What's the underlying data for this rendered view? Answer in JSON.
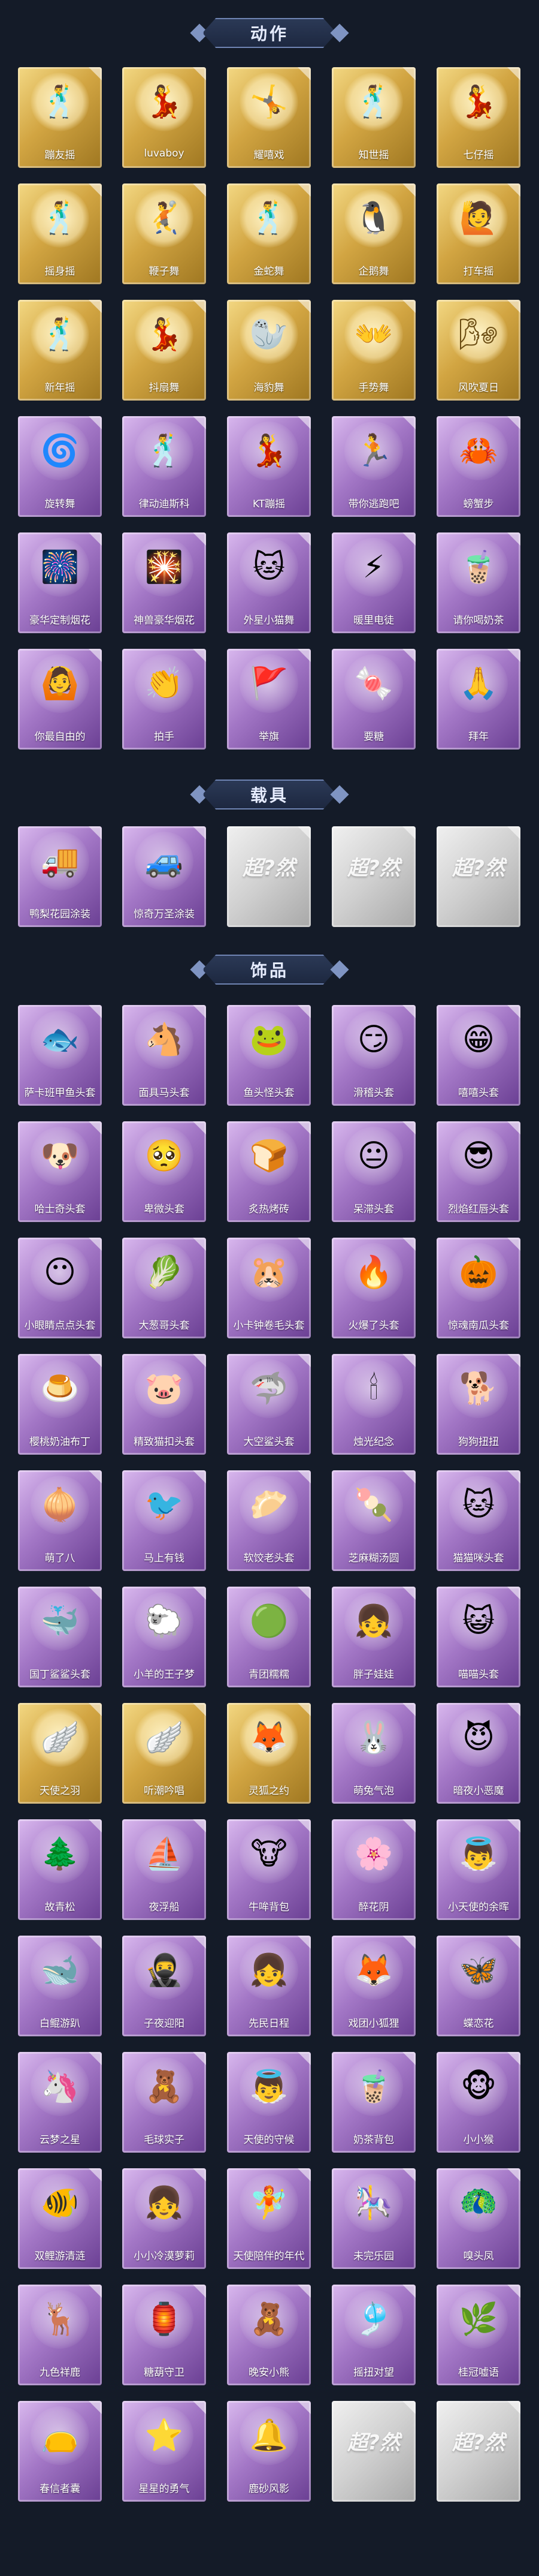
{
  "sections": [
    {
      "title": "动作",
      "items": [
        {
          "label": "蹦友摇",
          "icon": "dance-figure-icon",
          "glyph": "🕺",
          "style": "gold"
        },
        {
          "label": "luvaboy",
          "icon": "dance-figure-icon",
          "glyph": "💃",
          "style": "gold"
        },
        {
          "label": "耀嘻戏",
          "icon": "dance-figure-icon",
          "glyph": "🤸",
          "style": "gold"
        },
        {
          "label": "知世摇",
          "icon": "dance-figure-icon",
          "glyph": "🕺",
          "style": "gold"
        },
        {
          "label": "七仔摇",
          "icon": "dance-figure-icon",
          "glyph": "💃",
          "style": "gold"
        },
        {
          "label": "摇身摇",
          "icon": "dance-figure-icon",
          "glyph": "🕺",
          "style": "gold"
        },
        {
          "label": "鞭子舞",
          "icon": "dance-figure-icon",
          "glyph": "🤾",
          "style": "gold"
        },
        {
          "label": "金蛇舞",
          "icon": "dance-figure-icon",
          "glyph": "🕺",
          "style": "gold"
        },
        {
          "label": "企鹅舞",
          "icon": "dance-figure-icon",
          "glyph": "🐧",
          "style": "gold"
        },
        {
          "label": "打车摇",
          "icon": "dance-figure-icon",
          "glyph": "🙋",
          "style": "gold"
        },
        {
          "label": "新年摇",
          "icon": "dance-figure-icon",
          "glyph": "🕺",
          "style": "gold"
        },
        {
          "label": "抖扇舞",
          "icon": "dance-figure-icon",
          "glyph": "💃",
          "style": "gold"
        },
        {
          "label": "海豹舞",
          "icon": "dance-figure-icon",
          "glyph": "🦭",
          "style": "gold"
        },
        {
          "label": "手势舞",
          "icon": "dance-figure-icon",
          "glyph": "👐",
          "style": "gold"
        },
        {
          "label": "风吹夏日",
          "icon": "dance-figure-icon",
          "glyph": "🌬",
          "style": "gold"
        },
        {
          "label": "旋转舞",
          "icon": "dance-figure-icon",
          "glyph": "🌀",
          "style": "purple"
        },
        {
          "label": "律动迪斯科",
          "icon": "dance-figure-icon",
          "glyph": "🕺",
          "style": "purple"
        },
        {
          "label": "KT蹦摇",
          "icon": "dance-figure-icon",
          "glyph": "💃",
          "style": "purple"
        },
        {
          "label": "带你逃跑吧",
          "icon": "dance-figure-icon",
          "glyph": "🏃",
          "style": "purple"
        },
        {
          "label": "螃蟹步",
          "icon": "dance-figure-icon",
          "glyph": "🦀",
          "style": "purple"
        },
        {
          "label": "豪华定制烟花",
          "icon": "firework-icon",
          "glyph": "🎆",
          "style": "purple"
        },
        {
          "label": "神兽豪华烟花",
          "icon": "firework-icon",
          "glyph": "🎇",
          "style": "purple"
        },
        {
          "label": "外星小猫舞",
          "icon": "dance-figure-icon",
          "glyph": "🐱",
          "style": "purple"
        },
        {
          "label": "暖里电徒",
          "icon": "dance-figure-icon",
          "glyph": "⚡",
          "style": "purple"
        },
        {
          "label": "请你喝奶茶",
          "icon": "dance-figure-icon",
          "glyph": "🧋",
          "style": "purple"
        },
        {
          "label": "你最自由的",
          "icon": "dance-figure-icon",
          "glyph": "🙆",
          "style": "purple"
        },
        {
          "label": "拍手",
          "icon": "dance-figure-icon",
          "glyph": "👏",
          "style": "purple"
        },
        {
          "label": "举旗",
          "icon": "dance-figure-icon",
          "glyph": "🚩",
          "style": "purple"
        },
        {
          "label": "要糖",
          "icon": "dance-figure-icon",
          "glyph": "🍬",
          "style": "purple"
        },
        {
          "label": "拜年",
          "icon": "dance-figure-icon",
          "glyph": "🙏",
          "style": "purple"
        }
      ]
    },
    {
      "title": "载具",
      "items": [
        {
          "label": "鸭梨花园涂装",
          "icon": "vehicle-icon",
          "glyph": "🚚",
          "style": "purple"
        },
        {
          "label": "惊奇万圣涂装",
          "icon": "vehicle-icon",
          "glyph": "🚙",
          "style": "purple"
        },
        {
          "label": "",
          "icon": "placeholder-logo-icon",
          "glyph": "",
          "style": "gray",
          "logo": "超?然"
        },
        {
          "label": "",
          "icon": "placeholder-logo-icon",
          "glyph": "",
          "style": "gray",
          "logo": "超?然"
        },
        {
          "label": "",
          "icon": "placeholder-logo-icon",
          "glyph": "",
          "style": "gray",
          "logo": "超?然"
        }
      ]
    },
    {
      "title": "饰品",
      "items": [
        {
          "label": "萨卡班甲鱼头套",
          "icon": "fish-head-icon",
          "glyph": "🐟",
          "style": "purple"
        },
        {
          "label": "面具马头套",
          "icon": "horse-head-icon",
          "glyph": "🐴",
          "style": "purple"
        },
        {
          "label": "鱼头怪头套",
          "icon": "fish-head-icon",
          "glyph": "🐸",
          "style": "purple"
        },
        {
          "label": "滑稽头套",
          "icon": "smiley-icon",
          "glyph": "😏",
          "style": "purple"
        },
        {
          "label": "嘻嘻头套",
          "icon": "smiley-icon",
          "glyph": "😁",
          "style": "purple"
        },
        {
          "label": "哈士奇头套",
          "icon": "dog-head-icon",
          "glyph": "🐶",
          "style": "purple"
        },
        {
          "label": "卑微头套",
          "icon": "smiley-icon",
          "glyph": "🥺",
          "style": "purple"
        },
        {
          "label": "炙热烤砖",
          "icon": "toast-icon",
          "glyph": "🍞",
          "style": "purple"
        },
        {
          "label": "呆滞头套",
          "icon": "smiley-icon",
          "glyph": "😐",
          "style": "purple"
        },
        {
          "label": "烈焰红唇头套",
          "icon": "pikachu-head-icon",
          "glyph": "😎",
          "style": "purple"
        },
        {
          "label": "小眼睛点点头套",
          "icon": "creature-head-icon",
          "glyph": "😶",
          "style": "purple"
        },
        {
          "label": "大葱哥头套",
          "icon": "onion-head-icon",
          "glyph": "🥬",
          "style": "purple"
        },
        {
          "label": "小卡钟卷毛头套",
          "icon": "capybara-head-icon",
          "glyph": "🐹",
          "style": "purple"
        },
        {
          "label": "火爆了头套",
          "icon": "fire-head-icon",
          "glyph": "🔥",
          "style": "purple"
        },
        {
          "label": "惊魂南瓜头套",
          "icon": "pumpkin-head-icon",
          "glyph": "🎃",
          "style": "purple"
        },
        {
          "label": "樱桃奶油布丁",
          "icon": "pudding-icon",
          "glyph": "🍮",
          "style": "purple"
        },
        {
          "label": "精致猫扣头套",
          "icon": "pig-head-icon",
          "glyph": "🐷",
          "style": "purple"
        },
        {
          "label": "大空鲨头套",
          "icon": "shark-head-icon",
          "glyph": "🦈",
          "style": "purple"
        },
        {
          "label": "烛光纪念",
          "icon": "candle-icon",
          "glyph": "🕯",
          "style": "purple"
        },
        {
          "label": "狗狗扭扭",
          "icon": "dog-head-icon",
          "glyph": "🐕",
          "style": "purple"
        },
        {
          "label": "萌了八",
          "icon": "turnip-icon",
          "glyph": "🧅",
          "style": "purple"
        },
        {
          "label": "马上有钱",
          "icon": "bird-icon",
          "glyph": "🐦",
          "style": "purple"
        },
        {
          "label": "软饺老头套",
          "icon": "dumpling-icon",
          "glyph": "🥟",
          "style": "purple"
        },
        {
          "label": "芝麻糊汤圆",
          "icon": "rice-ball-icon",
          "glyph": "🍡",
          "style": "purple"
        },
        {
          "label": "猫猫咪头套",
          "icon": "cat-head-icon",
          "glyph": "🐱",
          "style": "purple"
        },
        {
          "label": "国丁鲨鲨头套",
          "icon": "shark-head-icon",
          "glyph": "🐳",
          "style": "purple"
        },
        {
          "label": "小羊的王子梦",
          "icon": "sheep-icon",
          "glyph": "🐑",
          "style": "purple"
        },
        {
          "label": "青团糯糯",
          "icon": "rice-ball-icon",
          "glyph": "🟢",
          "style": "purple"
        },
        {
          "label": "胖子娃娃",
          "icon": "doll-head-icon",
          "glyph": "👧",
          "style": "purple"
        },
        {
          "label": "喵喵头套",
          "icon": "cat-head-icon",
          "glyph": "😺",
          "style": "purple"
        },
        {
          "label": "天使之羽",
          "icon": "wings-icon",
          "glyph": "🪽",
          "style": "gold"
        },
        {
          "label": "听潮吟唱",
          "icon": "wings-icon",
          "glyph": "🪽",
          "style": "gold"
        },
        {
          "label": "灵狐之约",
          "icon": "fox-ears-icon",
          "glyph": "🦊",
          "style": "gold"
        },
        {
          "label": "萌兔气泡",
          "icon": "bunny-icon",
          "glyph": "🐰",
          "style": "purple"
        },
        {
          "label": "暗夜小恶魔",
          "icon": "devil-horns-icon",
          "glyph": "😈",
          "style": "purple"
        },
        {
          "label": "故青松",
          "icon": "bonsai-icon",
          "glyph": "🌲",
          "style": "purple"
        },
        {
          "label": "夜浮船",
          "icon": "ship-icon",
          "glyph": "⛵",
          "style": "purple"
        },
        {
          "label": "牛哞背包",
          "icon": "cow-backpack-icon",
          "glyph": "🐮",
          "style": "purple"
        },
        {
          "label": "醉花阴",
          "icon": "flower-icon",
          "glyph": "🌸",
          "style": "purple"
        },
        {
          "label": "小天使的余晖",
          "icon": "angel-icon",
          "glyph": "👼",
          "style": "purple"
        },
        {
          "label": "白鲲游趴",
          "icon": "whale-icon",
          "glyph": "🐋",
          "style": "purple"
        },
        {
          "label": "子夜迎阳",
          "icon": "character-icon",
          "glyph": "🥷",
          "style": "purple"
        },
        {
          "label": "先民日程",
          "icon": "character-icon",
          "glyph": "👧",
          "style": "purple"
        },
        {
          "label": "戏团小狐狸",
          "icon": "fox-icon",
          "glyph": "🦊",
          "style": "purple"
        },
        {
          "label": "蝶恋花",
          "icon": "butterfly-icon",
          "glyph": "🦋",
          "style": "purple"
        },
        {
          "label": "云梦之星",
          "icon": "unicorn-icon",
          "glyph": "🦄",
          "style": "purple"
        },
        {
          "label": "毛球实子",
          "icon": "character-icon",
          "glyph": "🧸",
          "style": "purple"
        },
        {
          "label": "天使的守候",
          "icon": "angel-icon",
          "glyph": "👼",
          "style": "purple"
        },
        {
          "label": "奶茶背包",
          "icon": "milk-tea-icon",
          "glyph": "🧋",
          "style": "purple"
        },
        {
          "label": "小小猴",
          "icon": "monkey-icon",
          "glyph": "🐵",
          "style": "purple"
        },
        {
          "label": "双鲤游清涟",
          "icon": "fish-icon",
          "glyph": "🐠",
          "style": "purple"
        },
        {
          "label": "小小冷漠萝莉",
          "icon": "character-icon",
          "glyph": "👧",
          "style": "purple"
        },
        {
          "label": "天使陪伴的年代",
          "icon": "character-icon",
          "glyph": "🧚",
          "style": "purple"
        },
        {
          "label": "未完乐园",
          "icon": "character-icon",
          "glyph": "🎠",
          "style": "purple"
        },
        {
          "label": "嗅头凤",
          "icon": "phoenix-icon",
          "glyph": "🦚",
          "style": "purple"
        },
        {
          "label": "九色祥鹿",
          "icon": "deer-icon",
          "glyph": "🦌",
          "style": "purple"
        },
        {
          "label": "糖葫守卫",
          "icon": "lantern-icon",
          "glyph": "🏮",
          "style": "purple"
        },
        {
          "label": "晚安小熊",
          "icon": "bear-icon",
          "glyph": "🧸",
          "style": "purple"
        },
        {
          "label": "摇扭对望",
          "icon": "pendant-icon",
          "glyph": "🎐",
          "style": "purple"
        },
        {
          "label": "桂冠嘘语",
          "icon": "wreath-icon",
          "glyph": "🌿",
          "style": "purple"
        },
        {
          "label": "春信者囊",
          "icon": "pouch-icon",
          "glyph": "👝",
          "style": "purple"
        },
        {
          "label": "星星的勇气",
          "icon": "star-icon",
          "glyph": "⭐",
          "style": "purple"
        },
        {
          "label": "鹿砂风影",
          "icon": "wind-chime-icon",
          "glyph": "🔔",
          "style": "purple"
        },
        {
          "label": "",
          "icon": "placeholder-logo-icon",
          "glyph": "",
          "style": "gray",
          "logo": "超?然"
        },
        {
          "label": "",
          "icon": "placeholder-logo-icon",
          "glyph": "",
          "style": "gray",
          "logo": "超?然"
        }
      ]
    }
  ]
}
